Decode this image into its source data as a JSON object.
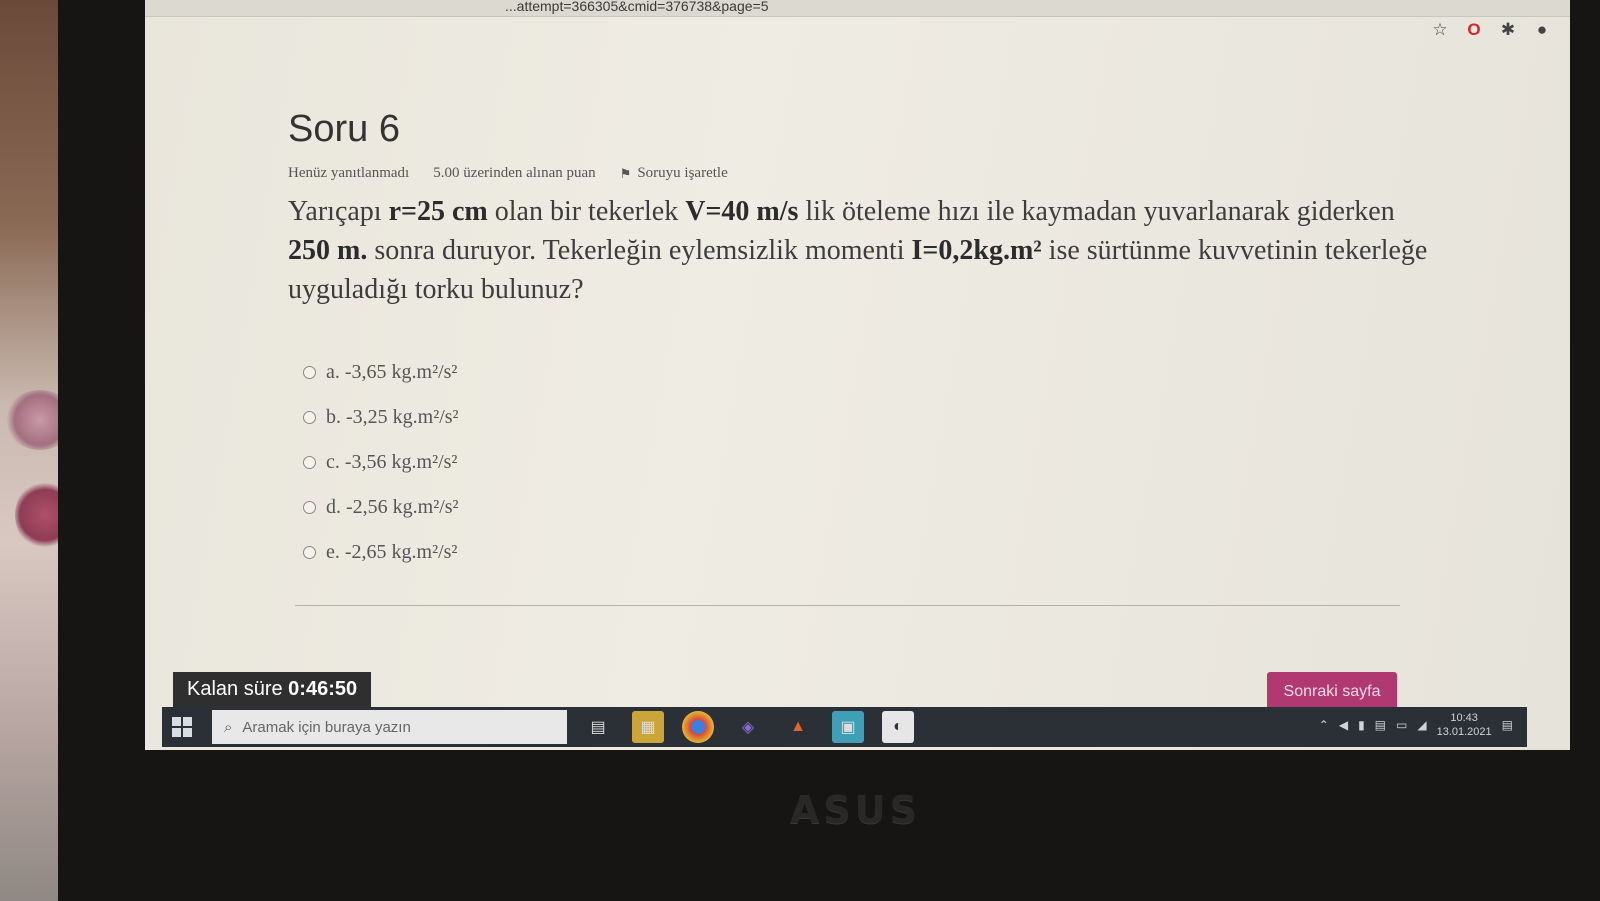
{
  "browser": {
    "url_fragment": "...attempt=366305&cmid=376738&page=5",
    "icons": [
      "star-icon",
      "opera-icon",
      "puzzle-icon",
      "profile-icon"
    ]
  },
  "question": {
    "title": "Soru 6",
    "status": "Henüz yanıtlanmadı",
    "points": "5.00 üzerinden alınan puan",
    "flag_label": "Soruyu işaretle",
    "text": {
      "p1": "Yarıçapı ",
      "r": "r=25 cm",
      "p2": " olan bir tekerlek ",
      "v": "V=40 m/s",
      "p3": " lik öteleme hızı ile kaymadan yuvarlanarak giderken ",
      "d": "250 m.",
      "p4": " sonra duruyor. Tekerleğin eylemsizlik momenti ",
      "i": "I=0,2kg.m²",
      "p5": " ise sürtünme kuvvetinin tekerleğe uyguladığı torku bulunuz?"
    },
    "answers": [
      {
        "label": "a. -3,65 kg.m²/s²"
      },
      {
        "label": "b. -3,25 kg.m²/s²"
      },
      {
        "label": "c. -3,56 kg.m²/s²"
      },
      {
        "label": "d. -2,56 kg.m²/s²"
      },
      {
        "label": "e. -2,65 kg.m²/s²"
      }
    ]
  },
  "timer": {
    "label": "Kalan süre ",
    "value": "0:46:50"
  },
  "next_button": "Sonraki sayfa",
  "taskbar": {
    "search_placeholder": "Aramak için buraya yazın",
    "time": "10:43",
    "date": "13.01.2021"
  },
  "laptop_brand": "ASUS"
}
